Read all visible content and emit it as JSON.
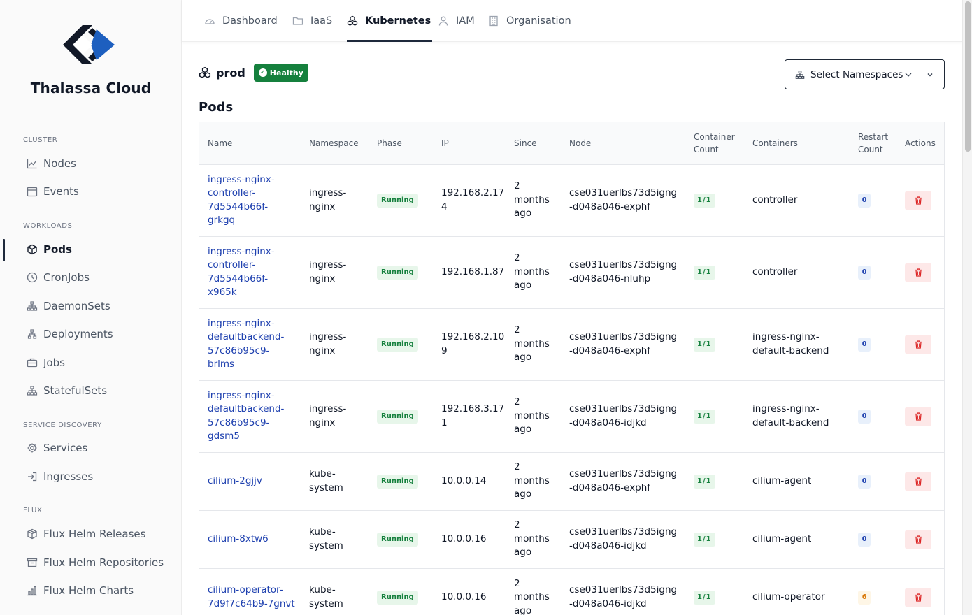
{
  "brand": {
    "name": "Thalassa Cloud"
  },
  "sidebar": {
    "sections": [
      {
        "label": "CLUSTER"
      },
      {
        "label": "WORKLOADS"
      },
      {
        "label": "SERVICE DISCOVERY"
      },
      {
        "label": "FLUX"
      }
    ],
    "items": [
      {
        "label": "Nodes",
        "icon": "chart-line-icon"
      },
      {
        "label": "Events",
        "icon": "calendar-icon"
      },
      {
        "label": "Pods",
        "icon": "cube-icon"
      },
      {
        "label": "CronJobs",
        "icon": "clock-icon"
      },
      {
        "label": "DaemonSets",
        "icon": "sitemap-icon"
      },
      {
        "label": "Deployments",
        "icon": "hierarchy-icon"
      },
      {
        "label": "Jobs",
        "icon": "briefcase-icon"
      },
      {
        "label": "StatefulSets",
        "icon": "sitemap-icon"
      },
      {
        "label": "Services",
        "icon": "gear-icon"
      },
      {
        "label": "Ingresses",
        "icon": "sign-in-icon"
      },
      {
        "label": "Flux Helm Releases",
        "icon": "package-icon"
      },
      {
        "label": "Flux Helm Repositories",
        "icon": "archive-icon"
      },
      {
        "label": "Flux Helm Charts",
        "icon": "bar-chart-icon"
      }
    ],
    "active_item": "Pods"
  },
  "topnav": {
    "tabs": [
      {
        "label": "Dashboard",
        "icon": "gauge-icon"
      },
      {
        "label": "IaaS",
        "icon": "folder-icon"
      },
      {
        "label": "Kubernetes",
        "icon": "cubes-icon"
      },
      {
        "label": "IAM",
        "icon": "user-icon"
      },
      {
        "label": "Organisation",
        "icon": "building-icon"
      }
    ],
    "active_tab": "Kubernetes"
  },
  "cluster": {
    "name": "prod",
    "status": "Healthy",
    "status_color": "#15803d"
  },
  "namespace_select": {
    "label": "Select Namespaces"
  },
  "pods": {
    "title": "Pods",
    "headers": {
      "name": "Name",
      "namespace": "Namespace",
      "phase": "Phase",
      "ip": "IP",
      "since": "Since",
      "node": "Node",
      "container_count": "Container Count",
      "containers": "Containers",
      "restart_count": "Restart Count",
      "actions": "Actions"
    },
    "rows": [
      {
        "name": "ingress-nginx-controller-7d5544b66f-grkgq",
        "namespace": "ingress-nginx",
        "phase": "Running",
        "ip": "192.168.2.174",
        "since": "2 months ago",
        "node": "cse031uerlbs73d5igng-d048a046-exphf",
        "container_count": "1/1",
        "containers": "controller",
        "restart_count": "0"
      },
      {
        "name": "ingress-nginx-controller-7d5544b66f-x965k",
        "namespace": "ingress-nginx",
        "phase": "Running",
        "ip": "192.168.1.87",
        "since": "2 months ago",
        "node": "cse031uerlbs73d5igng-d048a046-nluhp",
        "container_count": "1/1",
        "containers": "controller",
        "restart_count": "0"
      },
      {
        "name": "ingress-nginx-defaultbackend-57c86b95c9-brlms",
        "namespace": "ingress-nginx",
        "phase": "Running",
        "ip": "192.168.2.109",
        "since": "2 months ago",
        "node": "cse031uerlbs73d5igng-d048a046-exphf",
        "container_count": "1/1",
        "containers": "ingress-nginx-default-backend",
        "restart_count": "0"
      },
      {
        "name": "ingress-nginx-defaultbackend-57c86b95c9-gdsm5",
        "namespace": "ingress-nginx",
        "phase": "Running",
        "ip": "192.168.3.171",
        "since": "2 months ago",
        "node": "cse031uerlbs73d5igng-d048a046-idjkd",
        "container_count": "1/1",
        "containers": "ingress-nginx-default-backend",
        "restart_count": "0"
      },
      {
        "name": "cilium-2gjjv",
        "namespace": "kube-system",
        "phase": "Running",
        "ip": "10.0.0.14",
        "since": "2 months ago",
        "node": "cse031uerlbs73d5igng-d048a046-exphf",
        "container_count": "1/1",
        "containers": "cilium-agent",
        "restart_count": "0"
      },
      {
        "name": "cilium-8xtw6",
        "namespace": "kube-system",
        "phase": "Running",
        "ip": "10.0.0.16",
        "since": "2 months ago",
        "node": "cse031uerlbs73d5igng-d048a046-idjkd",
        "container_count": "1/1",
        "containers": "cilium-agent",
        "restart_count": "0"
      },
      {
        "name": "cilium-operator-7d9f7c64b9-7gnvt",
        "namespace": "kube-system",
        "phase": "Running",
        "ip": "10.0.0.16",
        "since": "2 months ago",
        "node": "cse031uerlbs73d5igng-d048a046-idjkd",
        "container_count": "1/1",
        "containers": "cilium-operator",
        "restart_count": "6"
      }
    ]
  }
}
